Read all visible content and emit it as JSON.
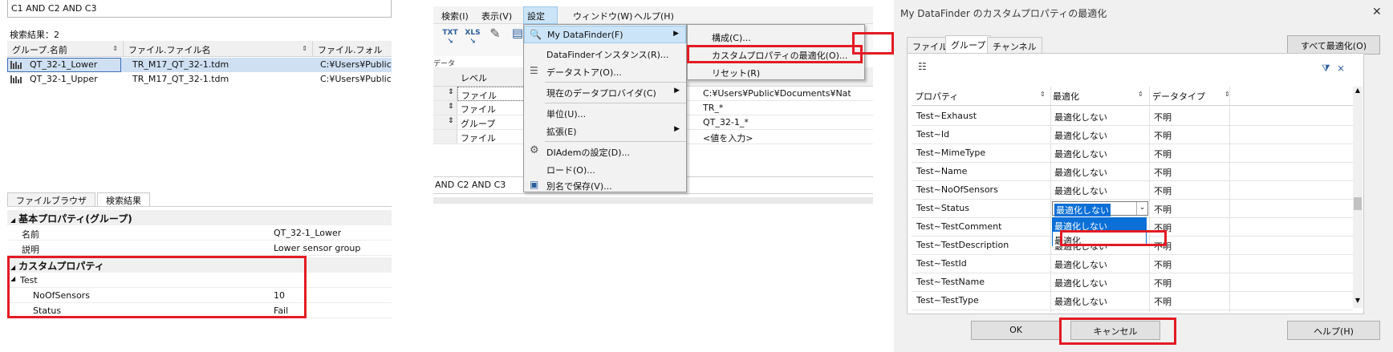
{
  "panel1": {
    "query": "C1 AND C2 AND C3",
    "result_count": "検索結果：2",
    "columns": [
      "グループ.名前",
      "ファイル.ファイル名",
      "ファイル.フォルダ"
    ],
    "rows": [
      [
        "QT_32-1_Lower",
        "TR_M17_QT_32-1.tdm",
        "C:¥Users¥Public¥"
      ],
      [
        "QT_32-1_Upper",
        "TR_M17_QT_32-1.tdm",
        "C:¥Users¥Public¥"
      ]
    ],
    "tabs": [
      "ファイルブラウザ",
      "検索結果"
    ],
    "basic_props_title": "基本プロパティ(グループ)",
    "basic_props": [
      {
        "label": "名前",
        "value": "QT_32-1_Lower"
      },
      {
        "label": "説明",
        "value": "Lower sensor group"
      }
    ],
    "custom_props_title": "カスタムプロパティ",
    "custom_group": "Test",
    "custom_props": [
      {
        "label": "NoOfSensors",
        "value": "10"
      },
      {
        "label": "Status",
        "value": "Fail"
      }
    ],
    "highlight_color": "#e31b23"
  },
  "panel2": {
    "menubar": [
      "検索(I)",
      "表示(V)",
      "設定(S)",
      "ウィンドウ(W)",
      "ヘルプ(H)"
    ],
    "toolbar": [
      "TXT",
      "XLS"
    ],
    "grid_label": "データ",
    "grid_header": "レベル",
    "grid_rows": [
      {
        "level": "ファイル",
        "value": "C:¥Users¥Public¥Documents¥Nat"
      },
      {
        "level": "ファイル",
        "value": "TR_*"
      },
      {
        "level": "グループ",
        "value": "QT_32-1_*"
      },
      {
        "level": "ファイル",
        "value": "<値を入力>"
      }
    ],
    "query": "AND C2 AND C3",
    "settings_menu": [
      "My DataFinder(F)",
      "DataFinderインスタンス(R)...",
      "データストア(O)...",
      "現在のデータプロバイダ(C)",
      "単位(U)...",
      "拡張(E)",
      "DIAdemの設定(D)...",
      "ロード(O)...",
      "別名で保存(V)..."
    ],
    "submenu": [
      "構成(C)...",
      "カスタムプロパティの最適化(O)...",
      "リセット(R)"
    ]
  },
  "panel3": {
    "title": "My DataFinder のカスタムプロパティの最適化",
    "tabs": [
      "ファイル",
      "グループ",
      "チャンネル"
    ],
    "optimize_all": "すべて最適化(O)",
    "columns": [
      "プロパティ",
      "最適化",
      "データタイプ"
    ],
    "rows": [
      {
        "prop": "Test~Exhaust",
        "opt": "最適化しない",
        "type": "不明"
      },
      {
        "prop": "Test~Id",
        "opt": "最適化しない",
        "type": "不明"
      },
      {
        "prop": "Test~MimeType",
        "opt": "最適化しない",
        "type": "不明"
      },
      {
        "prop": "Test~Name",
        "opt": "最適化しない",
        "type": "不明"
      },
      {
        "prop": "Test~NoOfSensors",
        "opt": "最適化しない",
        "type": "不明"
      },
      {
        "prop": "Test~Status",
        "opt": "最適化しない",
        "type": "不明"
      },
      {
        "prop": "Test~TestComment",
        "opt": "最適化しない",
        "type": "不明"
      },
      {
        "prop": "Test~TestDescription",
        "opt": "最適化しない",
        "type": "不明"
      },
      {
        "prop": "Test~TestId",
        "opt": "最適化しない",
        "type": "不明"
      },
      {
        "prop": "Test~TestName",
        "opt": "最適化しない",
        "type": "不明"
      },
      {
        "prop": "Test~TestType",
        "opt": "最適化しない",
        "type": "不明"
      }
    ],
    "dropdown_options": [
      "最適化しない",
      "最適化"
    ],
    "ok": "OK",
    "cancel": "キャンセル",
    "help": "ヘルプ(H)"
  }
}
